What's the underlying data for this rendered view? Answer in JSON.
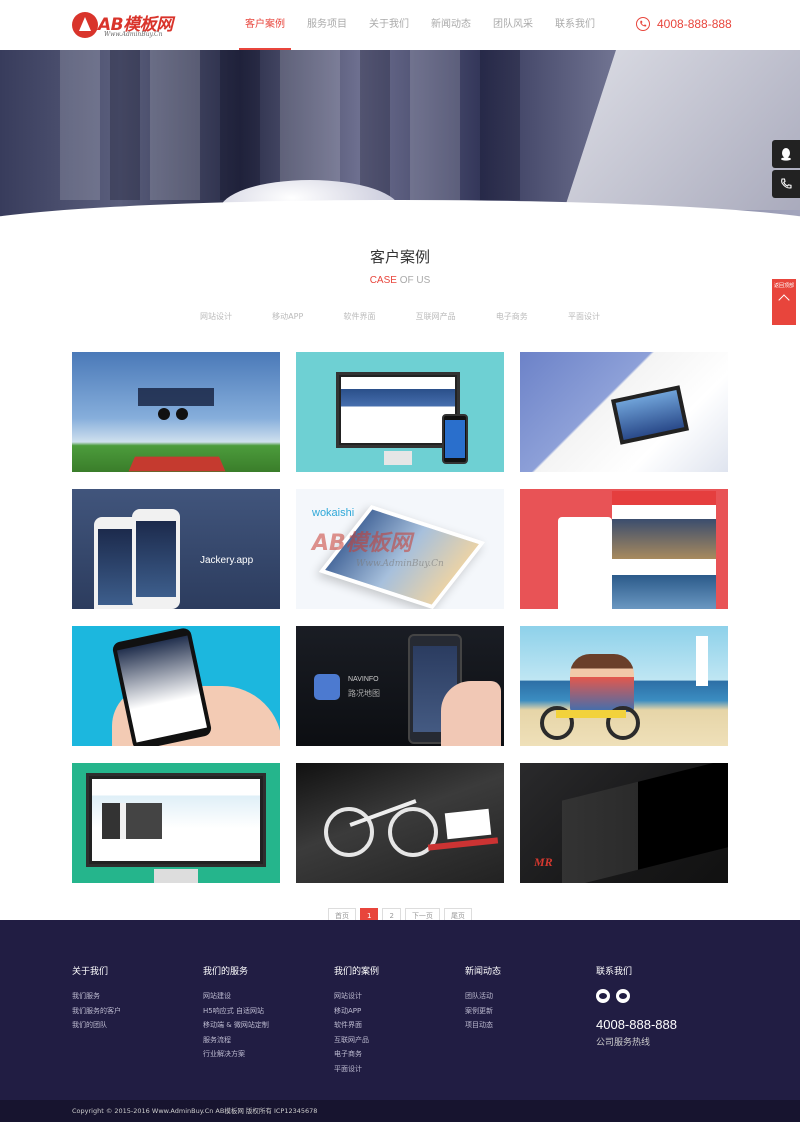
{
  "header": {
    "logo_text": "AB模板网",
    "logo_sub": "Www.AdminBuy.Cn",
    "nav": [
      {
        "label": "客户案例",
        "active": true
      },
      {
        "label": "服务项目",
        "active": false
      },
      {
        "label": "关于我们",
        "active": false
      },
      {
        "label": "新闻动态",
        "active": false
      },
      {
        "label": "团队风采",
        "active": false
      },
      {
        "label": "联系我们",
        "active": false
      }
    ],
    "phone": "4008-888-888"
  },
  "float": {
    "red_label": "返回顶部"
  },
  "section": {
    "title": "客户案例",
    "sub_highlight": "CASE",
    "sub_rest": " OF US",
    "categories": [
      "网站设计",
      "移动APP",
      "软件界面",
      "互联网产品",
      "电子商务",
      "平面设计"
    ]
  },
  "thumbs": {
    "t4_text": "Jackery.app",
    "t5_brand": "wokaishi",
    "t5_watermark": "AB模板网",
    "t5_watermark_sub": "Www.AdminBuy.Cn",
    "t8_brand": "NAVINFO",
    "t8_caption": "路况地图",
    "t12_mark": "MR"
  },
  "pagination": {
    "prev": "首页",
    "pages": [
      "1",
      "2"
    ],
    "next": "下一页",
    "last": "尾页"
  },
  "footer": {
    "columns": [
      {
        "title": "关于我们",
        "links": [
          "我们服务",
          "我们服务的客户",
          "我们的团队"
        ]
      },
      {
        "title": "我们的服务",
        "links": [
          "网站建设",
          "H5响应式 自适网站",
          "移动端 & 微网站定制",
          "服务流程",
          "行业解决方案"
        ]
      },
      {
        "title": "我们的案例",
        "links": [
          "网站设计",
          "移动APP",
          "软件界面",
          "互联网产品",
          "电子商务",
          "平面设计"
        ]
      },
      {
        "title": "新闻动态",
        "links": [
          "团队活动",
          "案例更新",
          "项目动态"
        ]
      }
    ],
    "contact": {
      "title": "联系我们",
      "phone": "4008-888-888",
      "phone_label": "公司服务热线"
    },
    "copyright": "Copyright © 2015-2016 Www.AdminBuy.Cn AB模板网 版权所有 ICP12345678"
  },
  "colors": {
    "accent": "#e8453c",
    "footer_bg": "#211d43"
  }
}
